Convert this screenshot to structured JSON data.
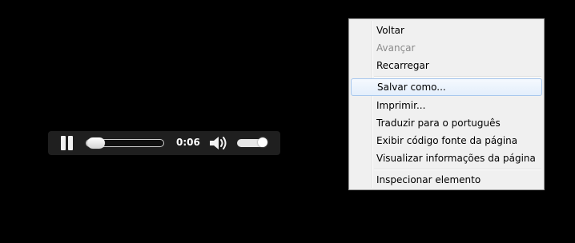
{
  "player": {
    "progress_fraction": 0.12,
    "time": "0:06",
    "volume_fraction": 0.9,
    "state": "playing"
  },
  "context_menu": {
    "items": [
      {
        "label": "Voltar",
        "enabled": true
      },
      {
        "label": "Avançar",
        "enabled": false
      },
      {
        "label": "Recarregar",
        "enabled": true
      },
      {
        "label": "Salvar como...",
        "enabled": true,
        "highlighted": true
      },
      {
        "label": "Imprimir...",
        "enabled": true
      },
      {
        "label": "Traduzir para o português",
        "enabled": true
      },
      {
        "label": "Exibir código fonte da página",
        "enabled": true
      },
      {
        "label": "Visualizar informações da página",
        "enabled": true
      },
      {
        "label": "Inspecionar elemento",
        "enabled": true
      }
    ]
  },
  "colors": {
    "background": "#000000",
    "player_bar": "#1f1f1f",
    "menu_background": "#f0f0f0",
    "menu_highlight_border": "#a8c8ee",
    "disabled_text": "#8a8a8a"
  },
  "icons": {
    "play_state": "pause-icon",
    "volume": "speaker-icon"
  }
}
